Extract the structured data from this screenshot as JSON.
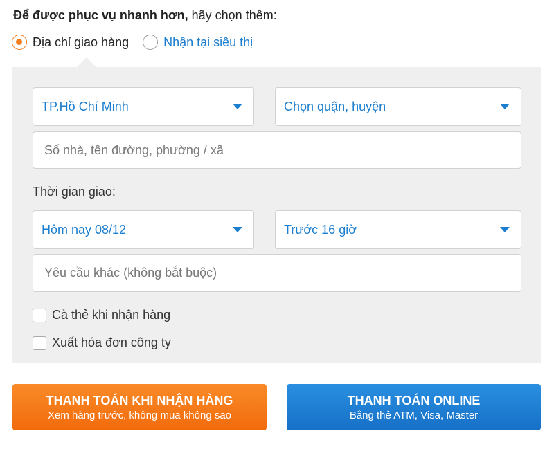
{
  "intro": {
    "bold": "Để được phục vụ nhanh hơn,",
    "rest": " hãy chọn thêm:"
  },
  "delivery_options": [
    {
      "label": "Địa chỉ giao hàng",
      "selected": true
    },
    {
      "label": "Nhận tại siêu thị",
      "selected": false
    }
  ],
  "address": {
    "city": "TP.Hồ Chí Minh",
    "district_placeholder": "Chọn quận, huyện",
    "street_placeholder": "Số nhà, tên đường, phường / xã"
  },
  "delivery_time": {
    "label": "Thời gian giao:",
    "day": "Hôm nay 08/12",
    "time": "Trước 16 giờ"
  },
  "notes_placeholder": "Yêu cầu khác (không bắt buộc)",
  "checkboxes": [
    {
      "label": "Cà thẻ khi nhận hàng",
      "checked": false
    },
    {
      "label": "Xuất hóa đơn công ty",
      "checked": false
    }
  ],
  "buttons": {
    "cod": {
      "title": "THANH TOÁN KHI NHẬN HÀNG",
      "subtitle": "Xem hàng trước, không mua không sao"
    },
    "online": {
      "title": "THANH TOÁN ONLINE",
      "subtitle": "Bằng thẻ ATM, Visa, Master"
    }
  },
  "colors": {
    "accent_orange": "#f27d1f",
    "accent_blue": "#1c7ecf",
    "panel_bg": "#efefef"
  }
}
